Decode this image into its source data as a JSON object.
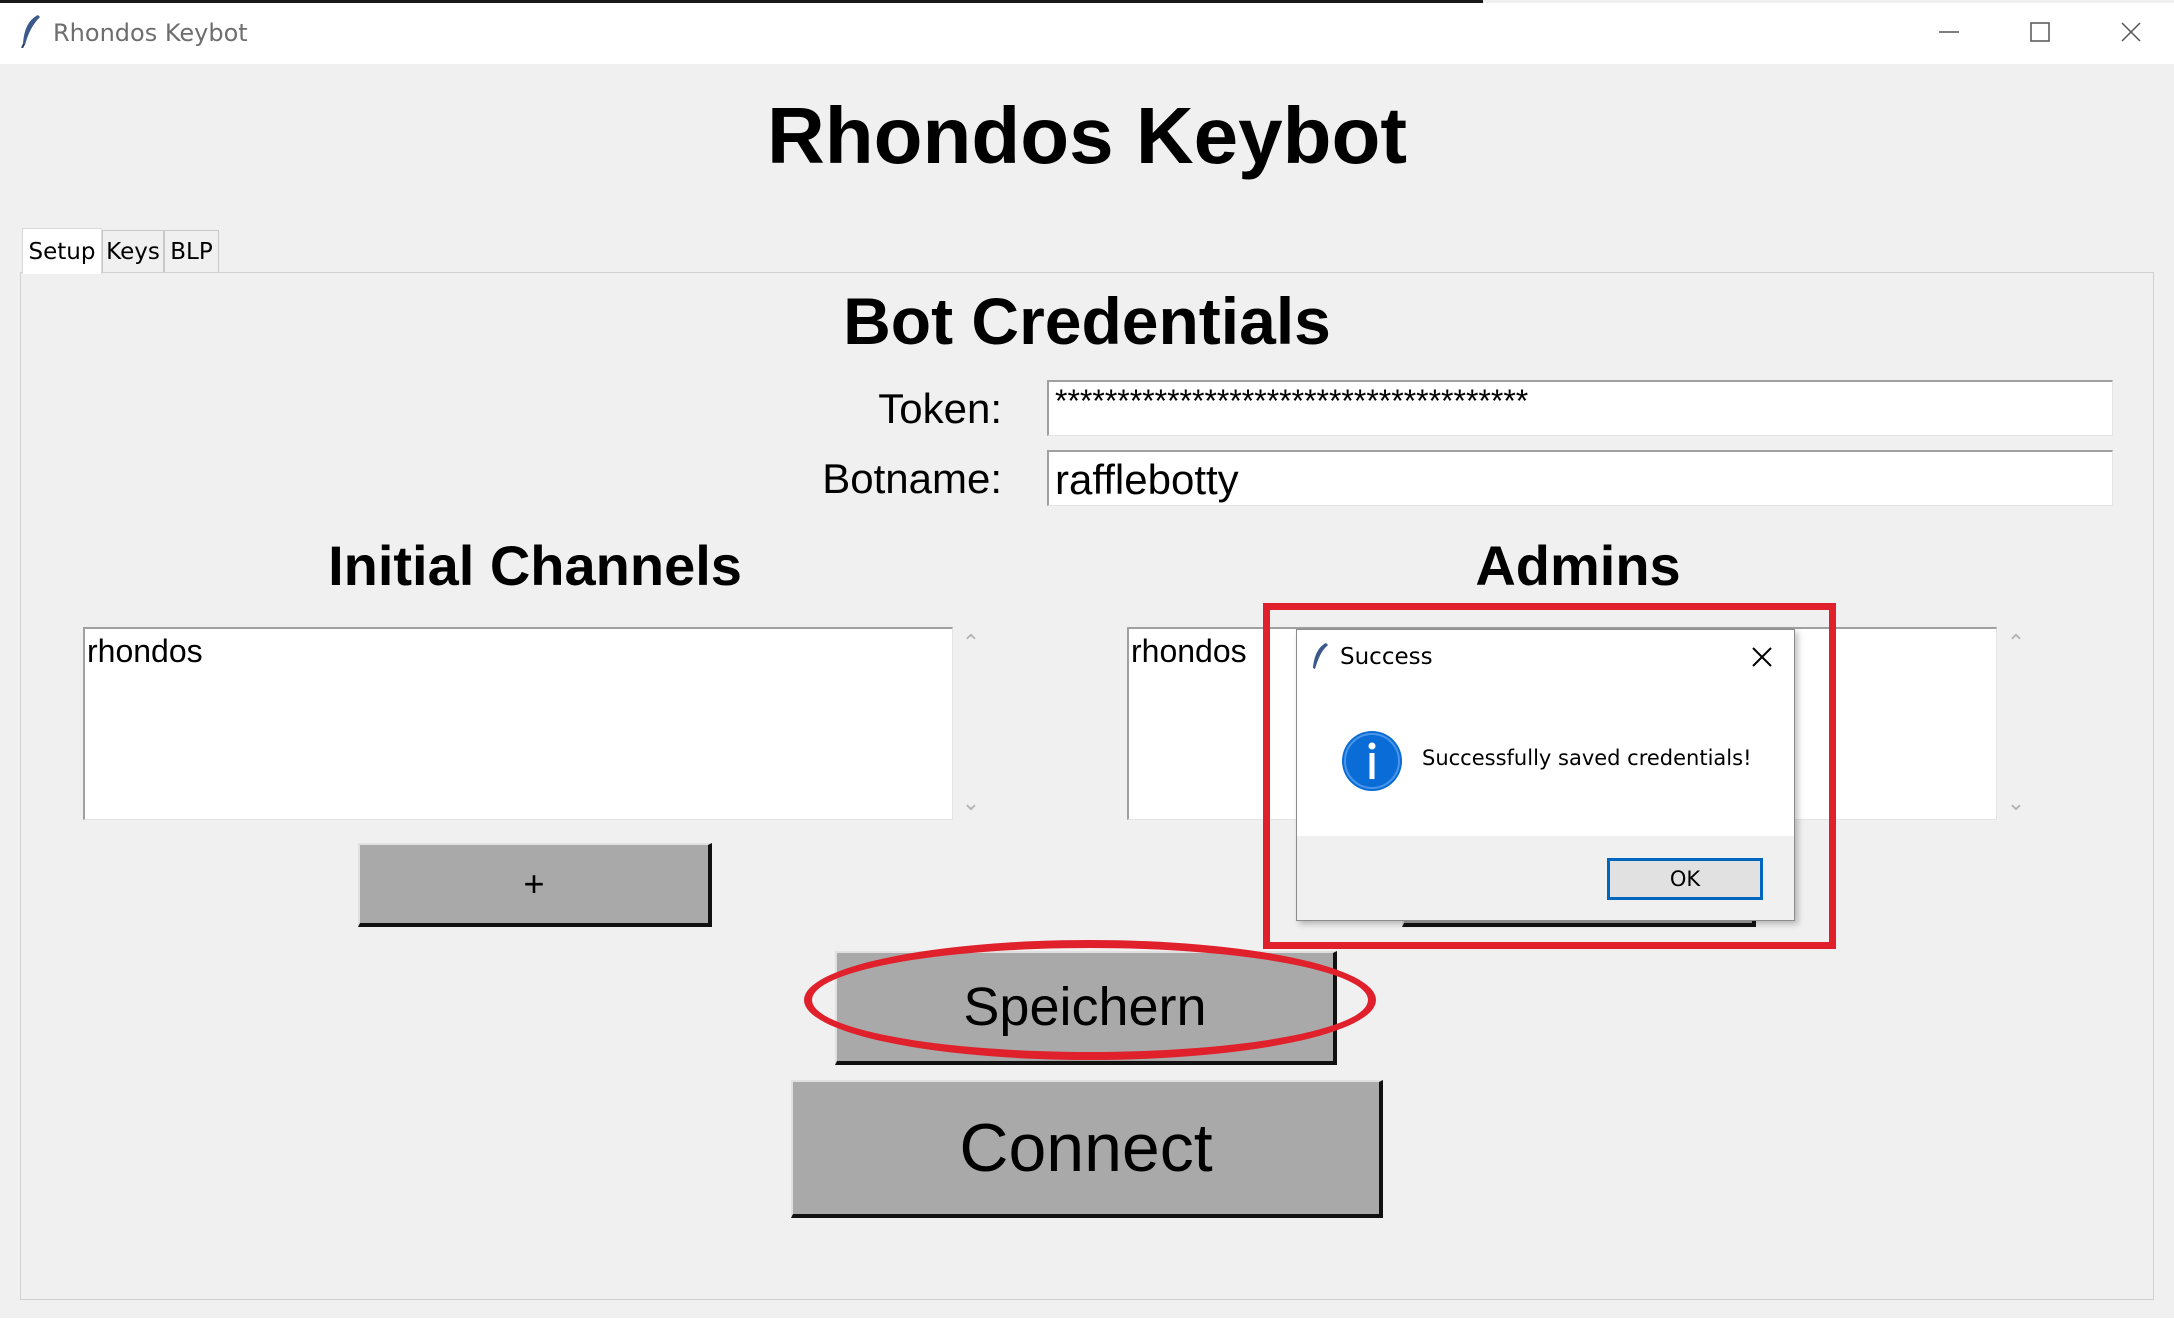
{
  "window": {
    "title": "Rhondos Keybot",
    "app_icon": "feather-icon",
    "controls": [
      "minimize-icon",
      "maximize-icon",
      "close-icon"
    ]
  },
  "app": {
    "heading": "Rhondos Keybot",
    "tabs": [
      {
        "label": "Setup",
        "selected": true
      },
      {
        "label": "Keys",
        "selected": false
      },
      {
        "label": "BLP",
        "selected": false
      }
    ]
  },
  "setup": {
    "section_title": "Bot Credentials",
    "token_label": "Token:",
    "token_value": "**************************************",
    "botname_label": "Botname:",
    "botname_value": "rafflebotty",
    "channels": {
      "title": "Initial Channels",
      "items": [
        "rhondos"
      ],
      "add_label": "+"
    },
    "admins": {
      "title": "Admins",
      "items": [
        "rhondos"
      ],
      "add_label": "+"
    },
    "save_label": "Speichern",
    "connect_label": "Connect"
  },
  "dialog": {
    "title": "Success",
    "message": "Successfully saved credentials!",
    "icon": "info-icon",
    "ok_label": "OK"
  },
  "annotations": {
    "color": "#e0202b",
    "marks": [
      "ellipse around save button",
      "rectangle around success dialog"
    ]
  },
  "colors": {
    "button_face": "#a9a9a9",
    "window_bg": "#f0f0f0",
    "info_blue": "#0a6cd6",
    "dialog_focus_border": "#0067c0"
  }
}
